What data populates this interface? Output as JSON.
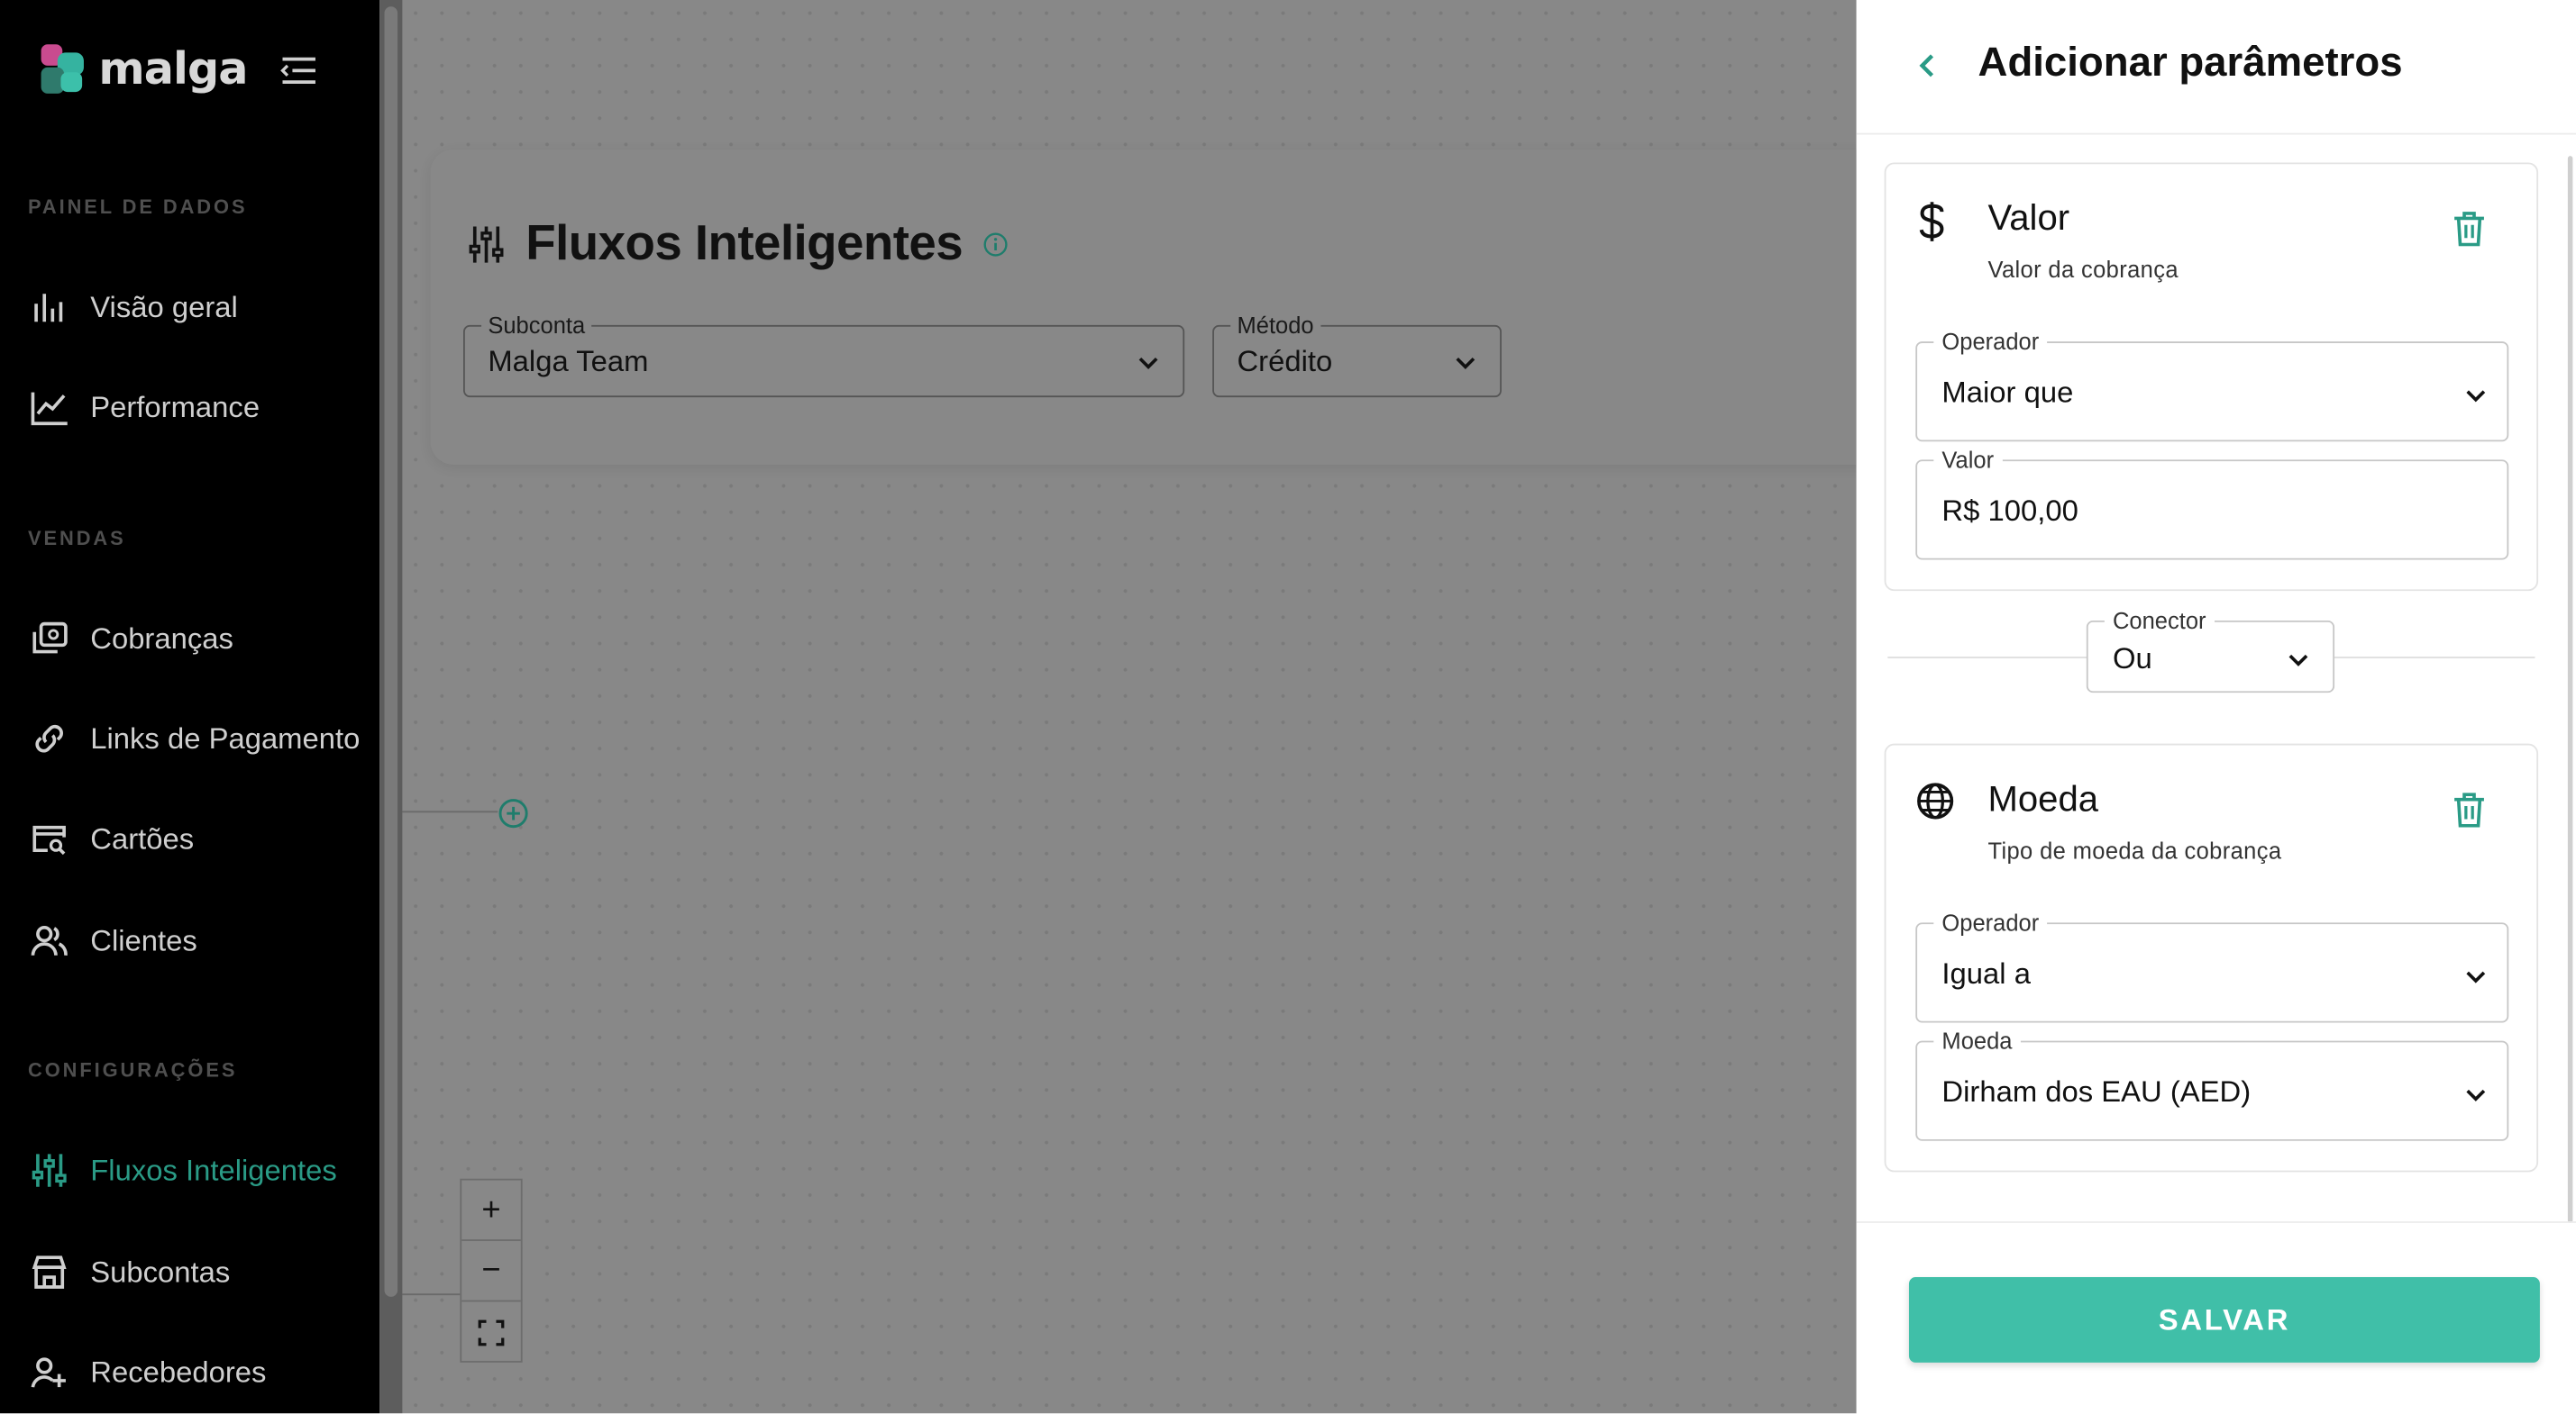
{
  "app": {
    "logo_text": "malga"
  },
  "sidebar": {
    "sections": [
      {
        "label": "PAINEL DE DADOS"
      },
      {
        "label": "VENDAS"
      },
      {
        "label": "CONFIGURAÇÕES"
      }
    ],
    "items": [
      {
        "label": "Visão geral",
        "icon": "bar-chart-icon"
      },
      {
        "label": "Performance",
        "icon": "line-chart-icon"
      },
      {
        "label": "Cobranças",
        "icon": "charges-icon"
      },
      {
        "label": "Links de Pagamento",
        "icon": "link-icon"
      },
      {
        "label": "Cartões",
        "icon": "card-search-icon"
      },
      {
        "label": "Clientes",
        "icon": "users-icon"
      },
      {
        "label": "Fluxos Inteligentes",
        "icon": "sliders-icon",
        "active": true
      },
      {
        "label": "Subcontas",
        "icon": "store-icon"
      },
      {
        "label": "Recebedores",
        "icon": "user-plus-icon"
      }
    ]
  },
  "main": {
    "title": "Fluxos Inteligentes",
    "subconta": {
      "label": "Subconta",
      "value": "Malga Team"
    },
    "metodo": {
      "label": "Método",
      "value": "Crédito"
    },
    "zoom": {
      "in": "+",
      "out": "−"
    }
  },
  "panel": {
    "title": "Adicionar parâmetros",
    "conditions": [
      {
        "title": "Valor",
        "subtitle": "Valor da cobrança",
        "icon": "dollar-icon",
        "operator": {
          "label": "Operador",
          "value": "Maior que"
        },
        "value_field": {
          "label": "Valor",
          "value": "R$ 100,00"
        }
      },
      {
        "title": "Moeda",
        "subtitle": "Tipo de moeda da cobrança",
        "icon": "globe-icon",
        "operator": {
          "label": "Operador",
          "value": "Igual a"
        },
        "value_field": {
          "label": "Moeda",
          "value": "Dirham dos EAU (AED)"
        }
      }
    ],
    "connector": {
      "label": "Conector",
      "value": "Ou"
    },
    "save_label": "SALVAR"
  },
  "colors": {
    "accent": "#40bfa8",
    "active_nav": "#2a9b86",
    "sidebar_bg": "#000000"
  }
}
